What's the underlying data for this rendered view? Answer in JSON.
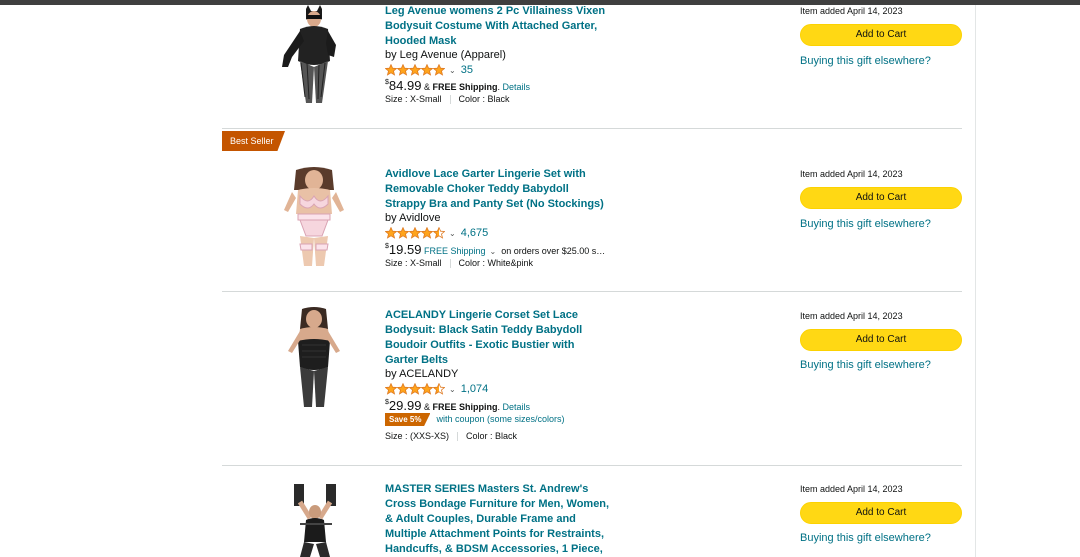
{
  "colors": {
    "accent_link": "#007185",
    "cart_button": "#ffd814",
    "best_seller": "#c45500",
    "save_badge": "#cc6600"
  },
  "items": [
    {
      "title": "Leg Avenue womens 2 Pc Villainess Vixen Bodysuit Costume With Attached Garter, Hooded Mask",
      "by": "by Leg Avenue (Apparel)",
      "rating": 5,
      "rating_count": "35",
      "price_symbol": "$",
      "price": "84.99",
      "shipping_prefix": " & ",
      "shipping": "FREE Shipping",
      "shipping_suffix": ". ",
      "details": "Details",
      "size": "Size : X-Small",
      "color": "Color : Black",
      "added": "Item added April 14, 2023",
      "cart": "Add to Cart",
      "gift": "Buying this gift elsewhere?"
    },
    {
      "badge": "Best Seller",
      "title": "Avidlove Lace Garter Lingerie Set with Removable Choker Teddy Babydoll Strappy Bra and Panty Set (No Stockings)",
      "by": "by Avidlove",
      "rating": 4.5,
      "rating_count": "4,675",
      "price_symbol": "$",
      "price": "19.59",
      "shipping": "FREE Shipping",
      "shipping_note": "on orders over $25.00 s…",
      "size": "Size : X-Small",
      "color": "Color : White&pink",
      "added": "Item added April 14, 2023",
      "cart": "Add to Cart",
      "gift": "Buying this gift elsewhere?"
    },
    {
      "title": "ACELANDY Lingerie Corset Set Lace Bodysuit: Black Satin Teddy Babydoll Boudoir Outfits - Exotic Bustier with Garter Belts",
      "by": "by ACELANDY",
      "rating": 4.5,
      "rating_count": "1,074",
      "price_symbol": "$",
      "price": "29.99",
      "shipping_prefix": " & ",
      "shipping": "FREE Shipping",
      "shipping_suffix": ". ",
      "details": "Details",
      "save": "Save 5%",
      "coupon": "with coupon (some sizes/colors)",
      "size": "Size : (XXS-XS)",
      "color": "Color : Black",
      "added": "Item added April 14, 2023",
      "cart": "Add to Cart",
      "gift": "Buying this gift elsewhere?"
    },
    {
      "title": "MASTER SERIES Masters St. Andrew's Cross Bondage Furniture for Men, Women, & Adult Couples, Durable Frame and Multiple Attachment Points for Restraints, Handcuffs, & BDSM Accessories, 1 Piece,",
      "added": "Item added April 14, 2023",
      "cart": "Add to Cart",
      "gift": "Buying this gift elsewhere?"
    }
  ]
}
